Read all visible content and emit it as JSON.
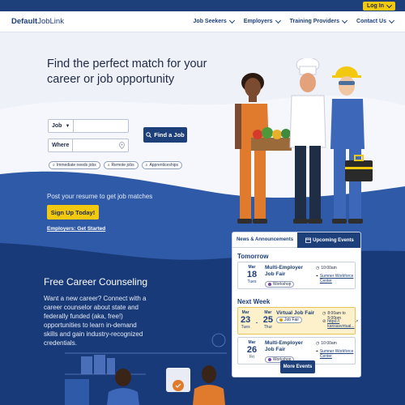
{
  "header": {
    "login_label": "Log In",
    "logo_bold": "Default",
    "logo_rest": "JobLink",
    "nav": [
      {
        "label": "Job Seekers"
      },
      {
        "label": "Employers"
      },
      {
        "label": "Training Providers"
      },
      {
        "label": "Contact Us"
      }
    ]
  },
  "hero": {
    "headline": "Find the perfect match for your career or job opportunity",
    "job_label": "Job",
    "where_label": "Where",
    "find_button": "Find a Job",
    "chips": [
      "Immediate needs jobs",
      "Remote jobs",
      "Apprenticeships"
    ],
    "post_text": "Post your resume to get job matches",
    "signup_button": "Sign Up Today!",
    "employers_link": "Employers: Get Started"
  },
  "counseling": {
    "title": "Free Career Counseling",
    "text": "Want a new career? Connect with a career counselor about state and federally funded (aka, free!) opportunities to learn in-demand skills and gain industry-recognized credentials."
  },
  "events": {
    "tab_news": "News & Announcements",
    "tab_events": "Upcoming Events",
    "tomorrow_heading": "Tomorrow",
    "next_week_heading": "Next Week",
    "event1": {
      "month": "Mar",
      "day": "18",
      "weekday": "Tues",
      "title": "Multi-Employer Job Fair",
      "badge": "Workshop",
      "time": "10:00am",
      "location": "Sumner Workforce Center"
    },
    "event2": {
      "month1": "Mar",
      "day1": "23",
      "weekday1": "Tues",
      "month2": "Mar",
      "day2": "25",
      "weekday2": "Thur",
      "title": "Virtual Job Fair",
      "badge": "Job Fair",
      "time": "8:00am to 5:00pm",
      "link": "https:// kansasvirtual..."
    },
    "event3": {
      "month": "Mar",
      "day": "26",
      "weekday": "Fri",
      "title": "Multi-Employer Job Fair",
      "badge": "Workshop",
      "time": "10:00am",
      "location": "Sumner Workforce Center"
    },
    "more_button": "More Events"
  },
  "colors": {
    "primary": "#1d3f7a",
    "accent": "#f3c90f",
    "wave": "#2f5aa8",
    "dark_band": "#193a78"
  }
}
